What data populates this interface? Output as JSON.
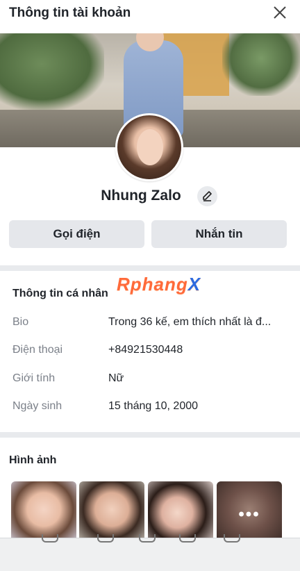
{
  "header": {
    "title": "Thông tin tài khoản"
  },
  "profile": {
    "name": "Nhung Zalo"
  },
  "actions": {
    "call_label": "Gọi điện",
    "message_label": "Nhắn tin"
  },
  "watermark": {
    "part1": "Rphang",
    "part2": "X"
  },
  "personal_info": {
    "title": "Thông tin cá nhân",
    "rows": [
      {
        "label": "Bio",
        "value": "Trong 36 kế, em thích nhất là đ..."
      },
      {
        "label": "Điện thoại",
        "value": "+84921530448"
      },
      {
        "label": "Giới tính",
        "value": "Nữ"
      },
      {
        "label": "Ngày sinh",
        "value": "15 tháng 10, 2000"
      }
    ]
  },
  "photos": {
    "title": "Hình ảnh",
    "more_label": "•••"
  },
  "colors": {
    "accent": "#2d6be0",
    "button_bg": "#e5e7eb",
    "divider": "#e8eaed"
  }
}
